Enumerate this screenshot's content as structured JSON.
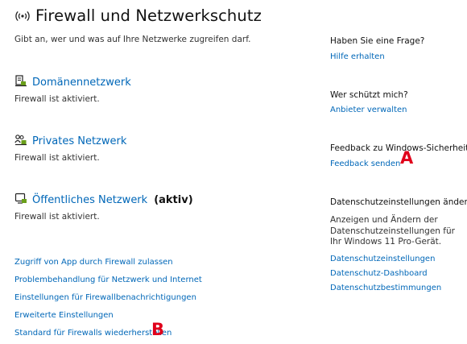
{
  "header": {
    "title": "Firewall und Netzwerkschutz",
    "subtitle": "Gibt an, wer und was auf Ihre Netzwerke zugreifen darf.",
    "icon": "broadcast-icon"
  },
  "networks": [
    {
      "name": "Domänennetzwerk",
      "status": "Firewall ist aktiviert.",
      "icon": "domain-network-icon"
    },
    {
      "name": "Privates Netzwerk",
      "status": "Firewall ist aktiviert.",
      "icon": "private-network-icon"
    },
    {
      "name": "Öffentliches Netzwerk",
      "active_label": "(aktiv)",
      "status": "Firewall ist aktiviert.",
      "icon": "public-network-icon"
    }
  ],
  "links": [
    "Zugriff von App durch Firewall zulassen",
    "Problembehandlung für Netzwerk und Internet",
    "Einstellungen für Firewallbenachrichtigungen",
    "Erweiterte Einstellungen",
    "Standard für Firewalls wiederherstellen"
  ],
  "sidebar": {
    "question": {
      "heading": "Haben Sie eine Frage?",
      "link": "Hilfe erhalten"
    },
    "protect": {
      "heading": "Wer schützt mich?",
      "link": "Anbieter verwalten"
    },
    "feedback": {
      "heading": "Feedback zu Windows-Sicherheit",
      "link": "Feedback senden"
    },
    "privacy": {
      "heading": "Datenschutzeinstellungen ändern",
      "text": "Anzeigen und Ändern der Datenschutzeinstellungen für Ihr Windows 11 Pro-Gerät.",
      "links": [
        "Datenschutzeinstellungen",
        "Datenschutz-Dashboard",
        "Datenschutzbestimmungen"
      ]
    }
  },
  "annotations": {
    "a": "A",
    "b": "B"
  },
  "colors": {
    "link": "#0067b8",
    "marker": "#e0001b"
  }
}
